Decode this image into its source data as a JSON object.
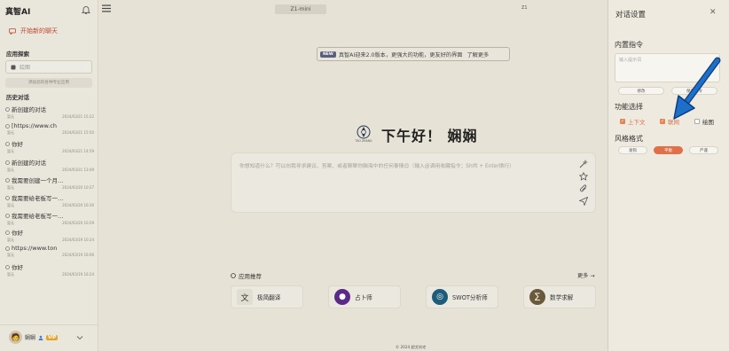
{
  "sidebar": {
    "brand": "真智AI",
    "new_chat": "开始新的聊天",
    "app_section": "应用探索",
    "app_search_placeholder": "绘图",
    "add_app": "添加您的各种专业应用",
    "history_section": "历史对话",
    "history": [
      {
        "title": "新创建的对话",
        "sub": "暂无",
        "time": "2024/03/21 15:22"
      },
      {
        "title": "[https://www.ch",
        "sub": "暂无",
        "time": "2024/03/21 15:50"
      },
      {
        "title": "你好",
        "sub": "暂无",
        "time": "2024/03/21 14:59"
      },
      {
        "title": "新创建的对话",
        "sub": "暂无",
        "time": "2024/03/21 13:49"
      },
      {
        "title": "我需要创建一个月…",
        "sub": "暂无",
        "time": "2024/03/20 10:27"
      },
      {
        "title": "我需要给老板写一…",
        "sub": "暂无",
        "time": "2024/03/20 10:30"
      },
      {
        "title": "我需要给老板写一…",
        "sub": "暂无",
        "time": "2024/03/20 10:29"
      },
      {
        "title": "你好",
        "sub": "暂无",
        "time": "2024/03/19 10:24"
      },
      {
        "title": "https://www.ton",
        "sub": "暂无",
        "time": "2024/03/19 16:06"
      },
      {
        "title": "你好",
        "sub": "暂无",
        "time": "2024/03/19 16:24"
      }
    ],
    "user": {
      "name": "娴娴",
      "badge": "VIP"
    }
  },
  "main": {
    "model": "Z1-mini",
    "top_right": "Z1",
    "banner": {
      "badge": "NEW",
      "text": "真智AI迎来2.0版本，更强大的功能，更友好的界面",
      "link": "了解更多"
    },
    "logo_text": "TAO ZHANG",
    "greeting": "下午好！ 娴娴",
    "input_placeholder": "你想知道什么？可以向我寻求建议、答案、或者聊聊你脑海中的任何事情😊（输入@调用收藏指令；Shift + Enter换行）",
    "recommend_title": "应用推荐",
    "more": "更多 →",
    "apps": [
      {
        "name": "极简翻译",
        "icon": "translate-icon",
        "color": "#4a4a4a"
      },
      {
        "name": "占卜师",
        "icon": "crystal-ball-icon",
        "color": "#5b2a86"
      },
      {
        "name": "SWOT分析师",
        "icon": "swot-icon",
        "color": "#1e5d7a"
      },
      {
        "name": "数学求解",
        "icon": "math-icon",
        "color": "#6b5a3a"
      }
    ],
    "copyright": "© 2024 超艾尚宅"
  },
  "panel": {
    "title": "对话设置",
    "instructions_label": "内置指令",
    "instructions_placeholder": "输入提示词",
    "edit_btn": "修改",
    "save_btn": "保存指令",
    "features_label": "功能选择",
    "features": [
      {
        "label": "上下文",
        "checked": true
      },
      {
        "label": "联网",
        "checked": true
      },
      {
        "label": "绘图",
        "checked": false
      }
    ],
    "style_label": "风格格式",
    "styles": [
      {
        "label": "发钩",
        "active": false
      },
      {
        "label": "平衡",
        "active": true
      },
      {
        "label": "严谨",
        "active": false
      }
    ]
  },
  "colors": {
    "accent": "#df7048",
    "arrow": "#1d6fc9"
  }
}
